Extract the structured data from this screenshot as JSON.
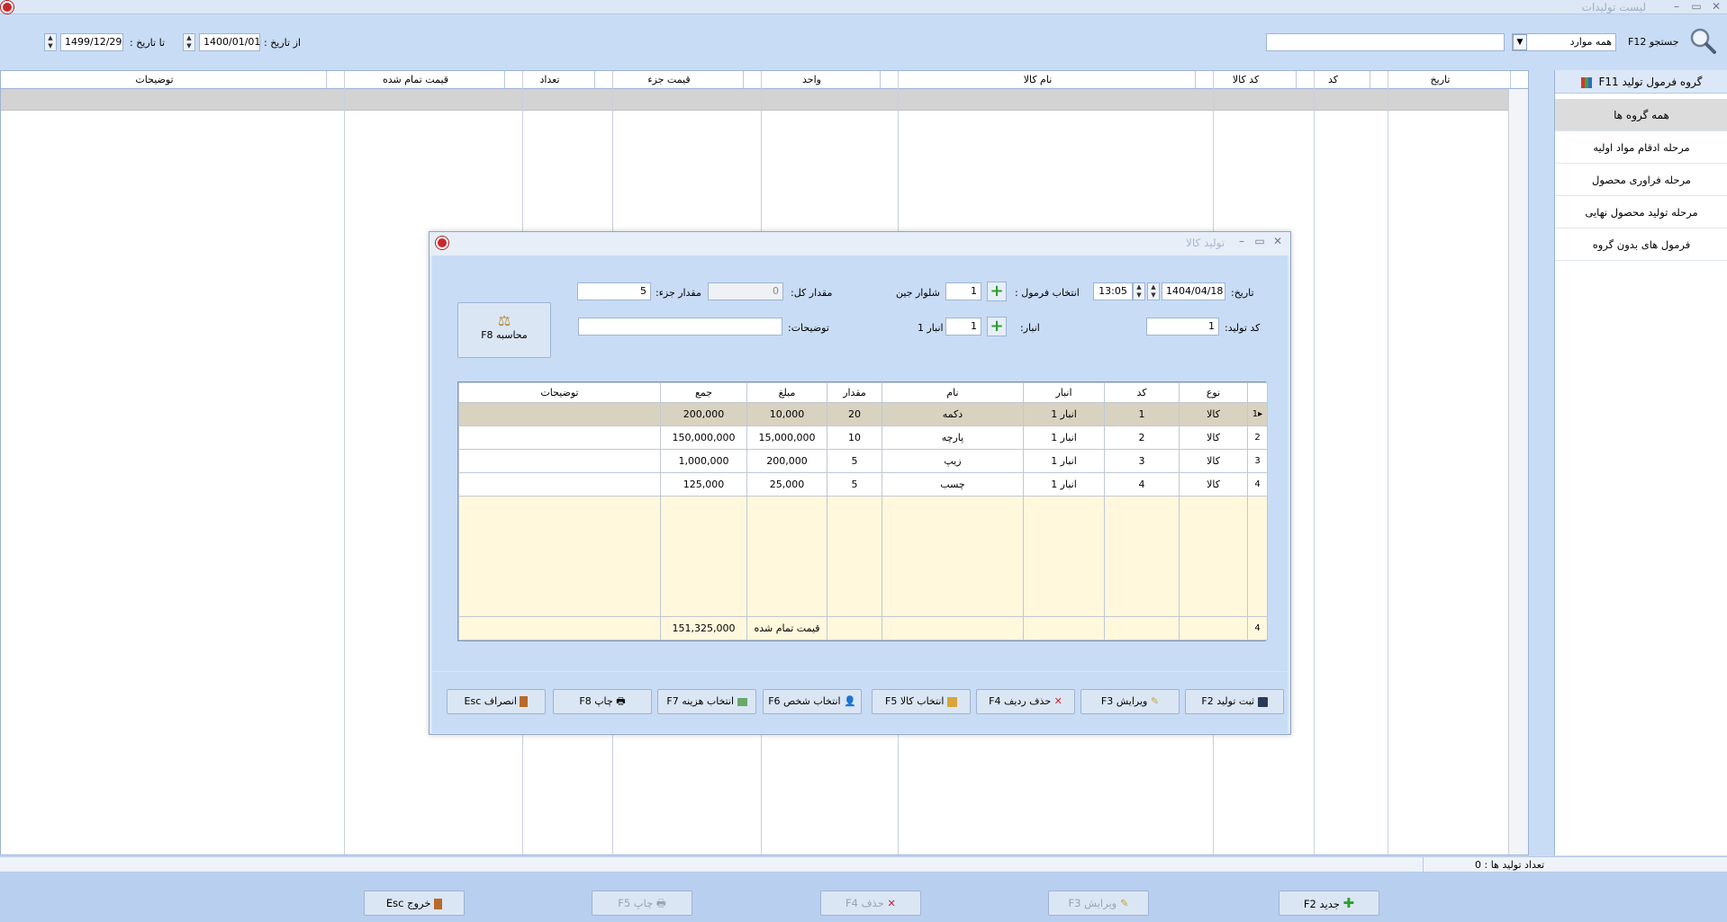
{
  "window": {
    "title": "لیست تولیدات"
  },
  "toolbar": {
    "search_label": "جستجو F12",
    "search_filter": "همه موارد",
    "search_value": "",
    "from_date_label": "از تاریخ :",
    "from_date": "1400/01/01",
    "to_date_label": "تا تاریخ :",
    "to_date": "1499/12/29"
  },
  "grid": {
    "columns": [
      "تاریخ",
      "کد",
      "کد کالا",
      "نام کالا",
      "واحد",
      "قیمت جزء",
      "تعداد",
      "قیمت تمام شده",
      "توضیحات"
    ]
  },
  "sidebar": {
    "header": "گروه فرمول تولید F11",
    "items": [
      {
        "label": "همه گروه ها",
        "active": true
      },
      {
        "label": "مرحله ادقام مواد اولیه",
        "active": false
      },
      {
        "label": "مرحله فراوری محصول",
        "active": false
      },
      {
        "label": "مرحله تولید محصول نهایی",
        "active": false
      },
      {
        "label": "فرمول های بدون گروه",
        "active": false
      }
    ]
  },
  "status": {
    "count_text": "تعداد تولید ها : 0"
  },
  "bottom_buttons": [
    {
      "label": "جدید F2",
      "icon": "plus-icon",
      "enabled": true
    },
    {
      "label": "ویرایش F3",
      "icon": "pencil-icon",
      "enabled": false
    },
    {
      "label": "حذف F4",
      "icon": "delete-x-icon",
      "enabled": false
    },
    {
      "label": "چاپ F5",
      "icon": "printer-icon",
      "enabled": false
    },
    {
      "label": "خروج Esc",
      "icon": "exit-door-icon",
      "enabled": true
    }
  ],
  "dialog": {
    "title": "تولید کالا",
    "date_label": "تاریخ:",
    "date": "1404/04/18",
    "time": "13:05",
    "formula_label": "انتخاب فرمول :",
    "formula_code": "1",
    "formula_name": "شلوار جین",
    "total_qty_label": "مقدار کل:",
    "total_qty": "0",
    "part_qty_label": "مقدار جزء:",
    "part_qty": "5",
    "prod_code_label": "کد تولید:",
    "prod_code": "1",
    "store_label": "انبار:",
    "store_code": "1",
    "store_name": "انبار 1",
    "desc_label": "توضیحات:",
    "desc_value": "",
    "calc_button": "محاسبه F8",
    "table": {
      "columns": [
        "",
        "نوع",
        "کد",
        "انبار",
        "نام",
        "مقدار",
        "مبلغ",
        "جمع",
        "توضیحات"
      ],
      "rows": [
        {
          "idx": "1",
          "type": "کالا",
          "code": "1",
          "store": "انبار 1",
          "name": "دکمه",
          "qty": "20",
          "price": "10,000",
          "sum": "200,000",
          "desc": ""
        },
        {
          "idx": "2",
          "type": "کالا",
          "code": "2",
          "store": "انبار 1",
          "name": "پارچه",
          "qty": "10",
          "price": "15,000,000",
          "sum": "150,000,000",
          "desc": ""
        },
        {
          "idx": "3",
          "type": "کالا",
          "code": "3",
          "store": "انبار 1",
          "name": "زیپ",
          "qty": "5",
          "price": "200,000",
          "sum": "1,000,000",
          "desc": ""
        },
        {
          "idx": "4",
          "type": "کالا",
          "code": "4",
          "store": "انبار 1",
          "name": "چسب",
          "qty": "5",
          "price": "25,000",
          "sum": "125,000",
          "desc": ""
        }
      ],
      "footer": {
        "count": "4",
        "label": "قیمت تمام شده",
        "total": "151,325,000"
      }
    },
    "buttons": [
      {
        "label": "ثبت تولید F2",
        "icon": "save-disk-icon"
      },
      {
        "label": "ویرایش F3",
        "icon": "pencil-icon"
      },
      {
        "label": "حذف ردیف F4",
        "icon": "delete-x-icon"
      },
      {
        "label": "انتخاب کالا F5",
        "icon": "goods-box-icon"
      },
      {
        "label": "انتخاب شخص F6",
        "icon": "person-icon"
      },
      {
        "label": "انتخاب هزینه F7",
        "icon": "cost-icon"
      },
      {
        "label": "چاپ F8",
        "icon": "printer-icon"
      },
      {
        "label": "انصراف Esc",
        "icon": "exit-door-icon"
      }
    ]
  },
  "colors": {
    "background": "#c9dcf5",
    "accent_red": "#c8282e",
    "plus_green": "#2aa12a",
    "row_selected": "#d8d3c0",
    "table_empty": "#fff8dc"
  }
}
